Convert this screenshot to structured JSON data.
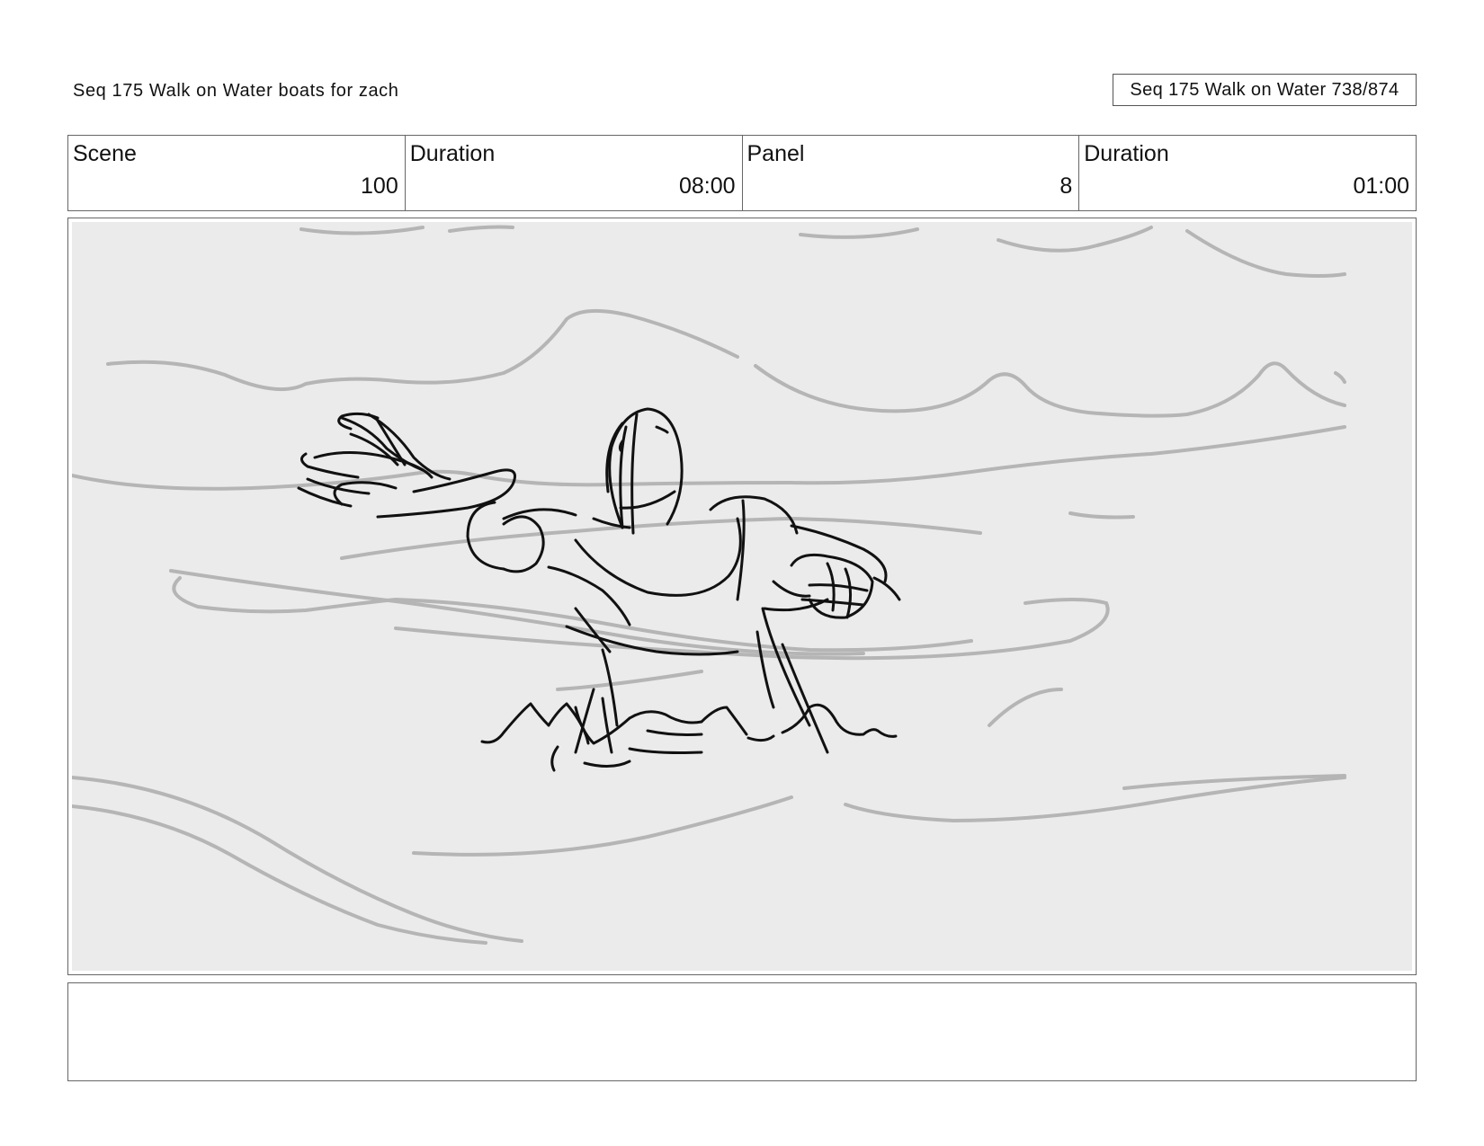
{
  "header": {
    "title": "Seq 175 Walk on Water  boats for zach",
    "page_id": "Seq 175 Walk on Water 738/874"
  },
  "info": {
    "scene_label": "Scene",
    "scene_value": "100",
    "scene_duration_label": "Duration",
    "scene_duration_value": "08:00",
    "panel_label": "Panel",
    "panel_value": "8",
    "panel_duration_label": "Duration",
    "panel_duration_value": "01:00"
  },
  "panel": {
    "background_color": "#ebebeb",
    "sketch_color": "#111111",
    "wave_color": "#b5b5b5"
  },
  "notes": {
    "text": ""
  }
}
